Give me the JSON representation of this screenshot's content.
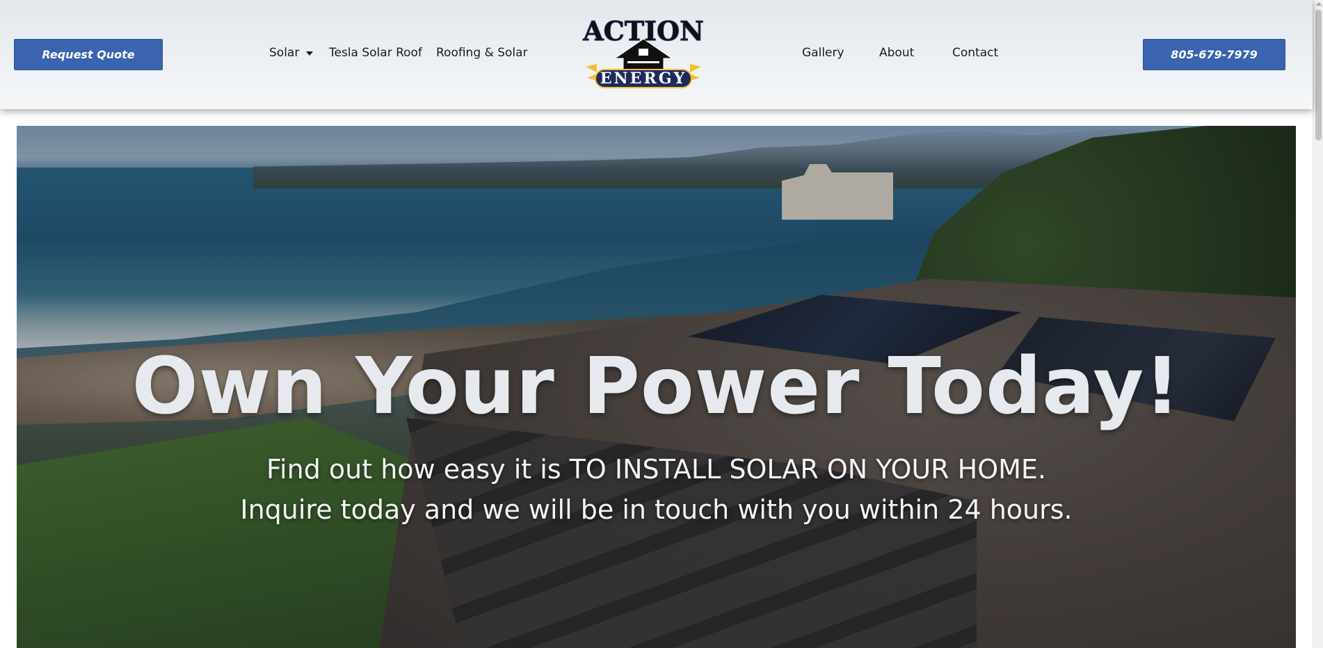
{
  "header": {
    "quote_button": "Request Quote",
    "phone_button": "805-679-7979",
    "nav_left": [
      {
        "label": "Solar",
        "has_dropdown": true
      },
      {
        "label": "Tesla Solar Roof"
      },
      {
        "label": "Roofing & Solar"
      }
    ],
    "nav_right": [
      {
        "label": "Gallery"
      },
      {
        "label": "About"
      },
      {
        "label": "Contact"
      }
    ],
    "logo": {
      "line1": "ACTION",
      "line2": "ENERGY"
    }
  },
  "hero": {
    "title": "Own Your Power Today!",
    "subtitle_line1": "Find out how easy it is TO INSTALL SOLAR ON YOUR HOME.",
    "subtitle_line2": "Inquire today and we will be in touch with you within 24 hours."
  },
  "colors": {
    "button_blue": "#3a63b0",
    "logo_navy": "#1e2a5e",
    "logo_gold": "#f1c232"
  }
}
